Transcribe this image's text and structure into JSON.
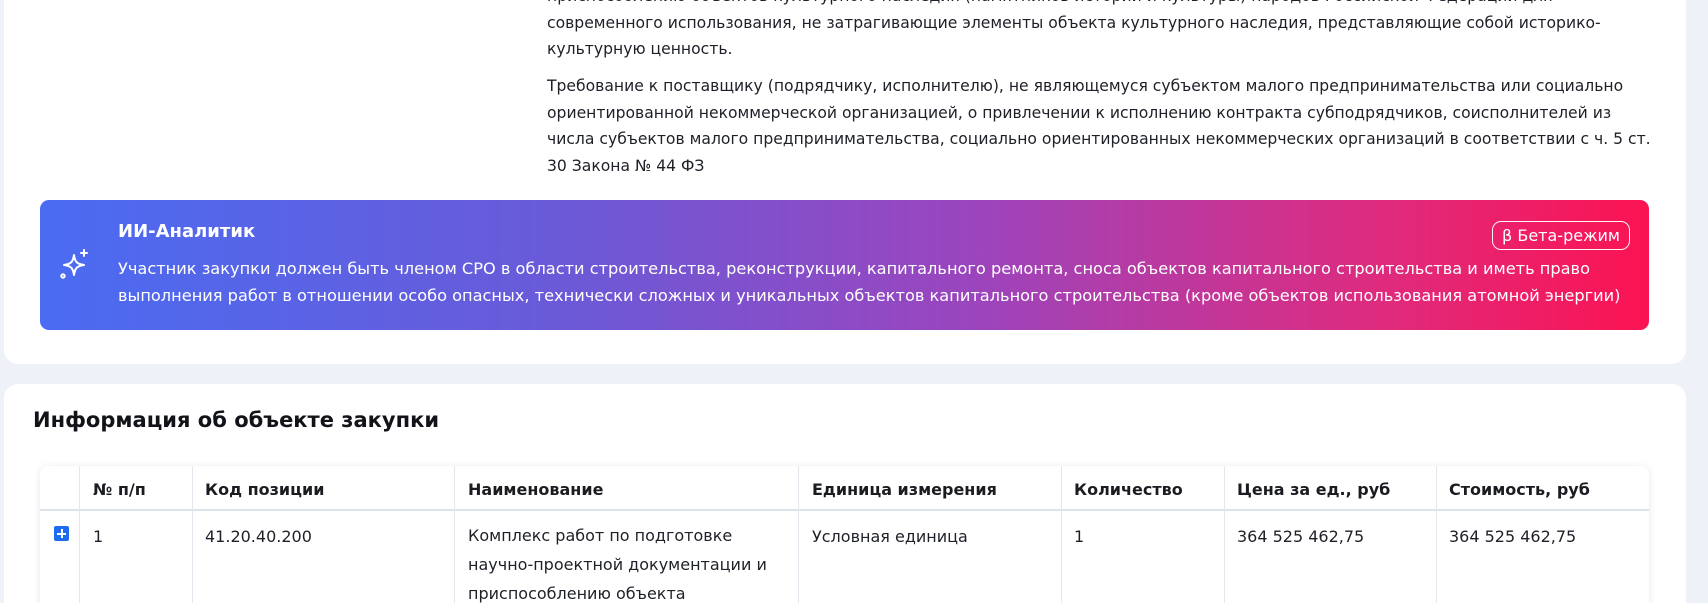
{
  "requirements": {
    "item1": "приспособлению объектов культурного наследия (памятников истории и культуры) народов Российской Федерации для современного использования, не затрагивающие элементы объекта культурного наследия, представляющие собой историко-культурную ценность.",
    "item2": "Требование к поставщику (подрядчику, исполнителю), не являющемуся субъектом малого предпринимательства или социально ориентированной некоммерческой организацией, о привлечении к исполнению контракта субподрядчиков, соисполнителей из числа субъектов малого предпринимательства, социально ориентированных некоммерческих организаций в соответствии с ч. 5 ст. 30 Закона № 44 ФЗ"
  },
  "ai_analyst": {
    "title": "ИИ-Аналитик",
    "badge": "β Бета-режим",
    "text": "Участник закупки должен быть членом СРО в области строительства, реконструкции, капитального ремонта, сноса объектов капитального строительства и иметь право выполнения работ в отношении особо опасных, технически сложных и уникальных объектов капитального строительства (кроме объектов использования атомной энергии)",
    "icon": "sparkle-icon",
    "gradient_start": "#4a6cf2",
    "gradient_end": "#fb1352"
  },
  "procurement": {
    "title": "Информация об объекте закупки",
    "columns": [
      "№ п/п",
      "Код позиции",
      "Наименование",
      "Единица измерения",
      "Количество",
      "Цена за ед., руб",
      "Стоимость, руб"
    ],
    "rows": [
      {
        "num": "1",
        "code": "41.20.40.200",
        "name": "Комплекс работ по подготовке научно-проектной документации и приспособлению объекта",
        "unit": "Условная единица",
        "qty": "1",
        "price": "364 525 462,75",
        "cost": "364 525 462,75",
        "expand_icon": "plus-square-icon"
      }
    ]
  },
  "colors": {
    "page_bg": "#eef2f8",
    "expand_button": "#1f6cf0"
  }
}
